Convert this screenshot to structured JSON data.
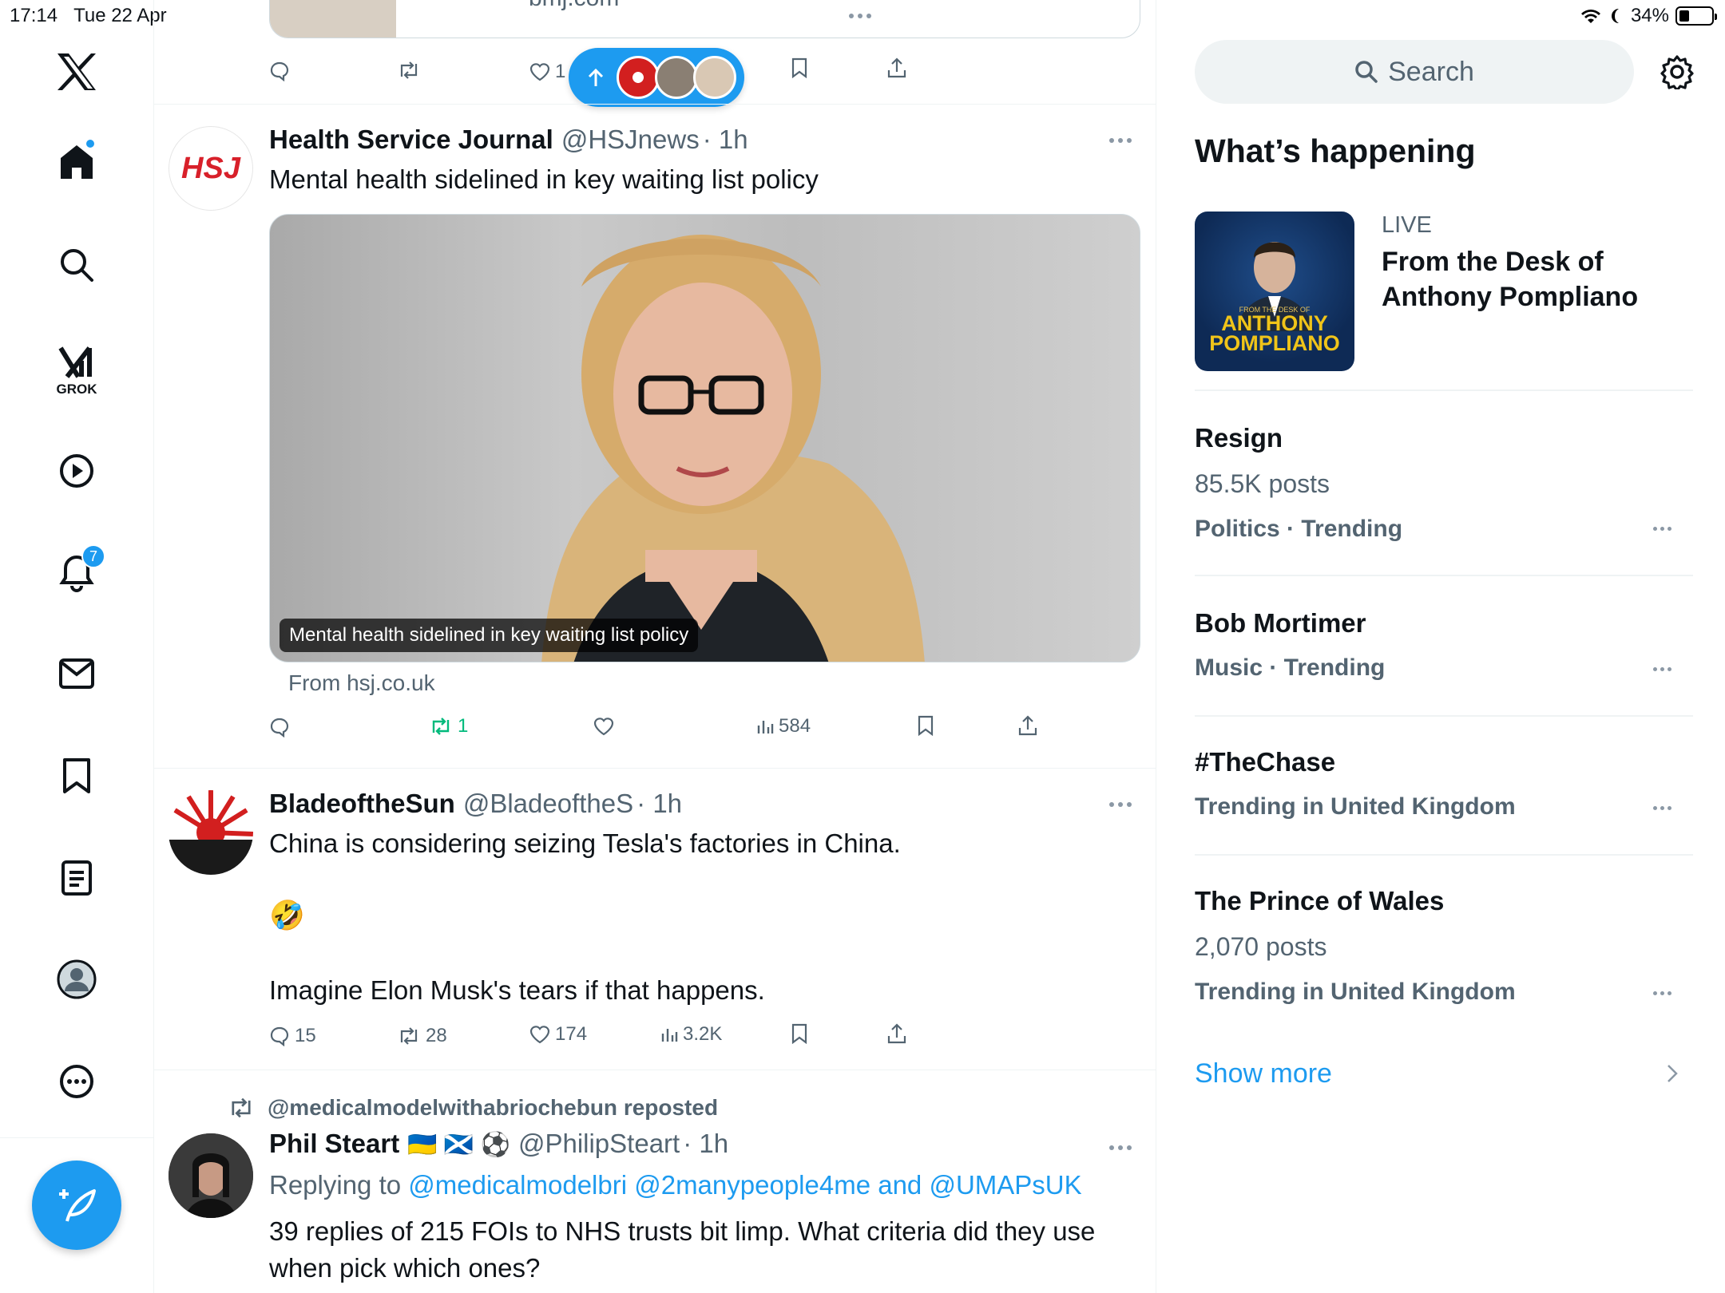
{
  "status": {
    "time": "17:14",
    "date": "Tue 22 Apr",
    "battery": "34%",
    "battery_level": 0.34
  },
  "nav": {
    "grok_label": "GROK",
    "notifications_count": "7",
    "icons": [
      "x-logo-icon",
      "home-icon",
      "search-icon",
      "grok-icon",
      "video-icon",
      "notifications-icon",
      "messages-icon",
      "bookmarks-icon",
      "lists-icon",
      "profile-icon",
      "more-icon",
      "compose-icon"
    ]
  },
  "prev_post": {
    "link_domain": "bmj.com",
    "likes": "1"
  },
  "posts": [
    {
      "name": "Health Service Journal",
      "handle": "@HSJnews",
      "time": "· 1h",
      "avatar_text": "HSJ",
      "text": "Mental health sidelined in key waiting list policy",
      "media_caption": "Mental health sidelined in key waiting list policy",
      "from": "From hsj.co.uk",
      "reposts": "1",
      "views": "584"
    },
    {
      "name": "BladeoftheSun",
      "handle": "@BladeoftheS",
      "time": "· 1h",
      "text1": "China is considering seizing Tesla's factories in China.",
      "emoji": "🤣",
      "text2": "Imagine Elon Musk's tears if that happens.",
      "replies": "15",
      "reposts": "28",
      "likes": "174",
      "views": "3.2K"
    },
    {
      "repost_by": "@medicalmodelwithabriochebun reposted",
      "name": "Phil Steart",
      "flags": "🇺🇦 🏴󠁧󠁢󠁳󠁣󠁴󠁿 ⚽",
      "handle": "@PhilipSteart",
      "time": "· 1h",
      "replying_prefix": "Replying to",
      "replying_to": "@medicalmodelbri @2manypeople4me and @UMAPsUK",
      "text": "39 replies of 215 FOIs to NHS trusts bit limp. What criteria did they use when pick which ones?"
    }
  ],
  "right": {
    "search_placeholder": "Search",
    "title": "What’s happening",
    "live": {
      "label": "LIVE",
      "title": "From the Desk of Anthony Pompliano",
      "img_small": "FROM THE DESK OF",
      "img_big": "ANTHONY POMPLIANO"
    },
    "trends": [
      {
        "title": "Resign",
        "posts": "85.5K posts",
        "category": "Politics · Trending"
      },
      {
        "title": "Bob Mortimer",
        "posts": "",
        "category": "Music · Trending"
      },
      {
        "title": "#TheChase",
        "posts": "",
        "category": "Trending in United Kingdom"
      },
      {
        "title": "The Prince of Wales",
        "posts": "2,070 posts",
        "category": "Trending in United Kingdom"
      }
    ],
    "show_more": "Show more"
  },
  "colors": {
    "accent": "#1d9bf0",
    "repost_green": "#00ba7c",
    "muted": "#536471"
  }
}
